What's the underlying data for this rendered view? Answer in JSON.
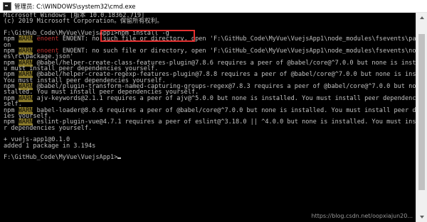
{
  "window": {
    "title": "管理员: C:\\WINDOWS\\system32\\cmd.exe",
    "icon": "cmd-icon"
  },
  "console": {
    "lines": [
      {
        "text": "Microsoft Windows [版本 10.0.18362.719]"
      },
      {
        "text": "(c) 2019 Microsoft Corporation。保留所有权利。"
      },
      {
        "text": ""
      },
      {
        "prefix": "F:\\GitHub_Code\\MyVue\\VuejsApp1>",
        "command": "npm install -g"
      },
      {
        "npm": "npm",
        "tag": "WARN",
        "tag_type": "warn",
        "tag2": "enoent",
        "rest": " ENOENT: no such file or directory, open 'F:\\GitHub_Code\\MyVue\\VuejsApp1\\node_modules\\fsevents\\package.js"
      },
      {
        "text": "on"
      },
      {
        "npm": "npm",
        "tag": "WARN",
        "tag_type": "warn",
        "tag2": "enoent",
        "rest": " ENOENT: no such file or directory, open 'F:\\GitHub_Code\\MyVue\\VuejsApp1\\node_modules\\fsevents\\node_module"
      },
      {
        "text": "es\\rc\\package.json'"
      },
      {
        "npm": "npm",
        "tag": "WARN",
        "tag_type": "warn",
        "rest": " @babel/helper-create-class-features-plugin@7.8.6 requires a peer of @babel/core@^7.0.0 but none is installed. Yo"
      },
      {
        "text": "u must install peer dependencies yourself."
      },
      {
        "npm": "npm",
        "tag": "WARN",
        "tag_type": "warn",
        "rest": " @babel/helper-create-regexp-features-plugin@7.8.8 requires a peer of @babel/core@^7.0.0 but none is installed."
      },
      {
        "text": "You must install peer dependencies yourself."
      },
      {
        "npm": "npm",
        "tag": "WARN",
        "tag_type": "warn",
        "rest": " @babel/plugin-transform-named-capturing-groups-regex@7.8.3 requires a peer of @babel/core@^7.0.0 but none is in"
      },
      {
        "text": "stalled. You must install peer dependencies yourself."
      },
      {
        "npm": "npm",
        "tag": "WARN",
        "tag_type": "warn",
        "rest": " ajv-keywords@2.1.1 requires a peer of ajv@^5.0.0 but none is installed. You must install peer dependencies your"
      },
      {
        "text": "self."
      },
      {
        "npm": "npm",
        "tag": "WARN",
        "tag_type": "warn",
        "rest": " babel-loader@8.0.6 requires a peer of @babel/core@^7.0.0 but none is installed. You must install peer dependenc"
      },
      {
        "text": "ies yourself."
      },
      {
        "npm": "npm",
        "tag": "WARN",
        "tag_type": "warn",
        "rest": " eslint-plugin-vue@4.7.1 requires a peer of eslint@^3.18.0 || ^4.0.0 but none is installed. You must install pee"
      },
      {
        "text": "r dependencies yourself."
      },
      {
        "text": ""
      },
      {
        "text": "+ vuejs-app1@0.1.0"
      },
      {
        "text": "added 1 package in 3.194s"
      },
      {
        "text": ""
      },
      {
        "prefix": "F:\\GitHub_Code\\MyVue\\VuejsApp1>",
        "cursor": true
      }
    ]
  },
  "watermark": "https://blog.csdn.net/oopxiajun20..."
}
